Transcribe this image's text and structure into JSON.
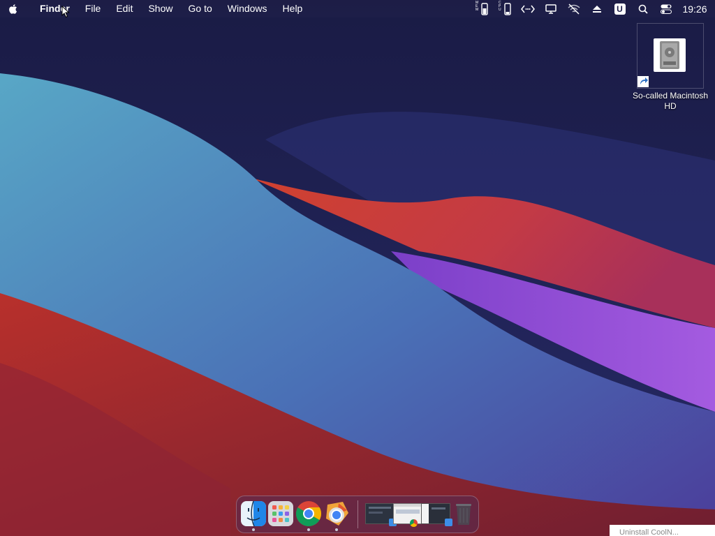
{
  "menubar": {
    "apple_icon": "apple-logo-icon",
    "items": [
      "Finder",
      "File",
      "Edit",
      "Show",
      "Go to",
      "Windows",
      "Help"
    ],
    "status_icons": [
      "memory-monitor-icon",
      "cpu-monitor-icon",
      "code-icon",
      "display-icon",
      "wifi-off-icon",
      "eject-icon",
      "u-app-icon",
      "search-icon",
      "control-center-icon"
    ],
    "mem_label": "MEM",
    "cpu_label": "CPU",
    "u_label": "U",
    "clock": "19:26"
  },
  "desktop": {
    "drive_label": "So-called Macintosh HD"
  },
  "dock": {
    "apps": [
      "finder-icon",
      "launchpad-icon",
      "chrome-icon",
      "chrome-alt-icon"
    ],
    "recent": [
      "window-thumbnail-1",
      "window-thumbnail-2",
      "window-thumbnail-3"
    ],
    "trash": "trash-icon"
  },
  "notice": {
    "text": "Uninstall CoolN..."
  },
  "colors": {
    "sky": "#1b1d4a",
    "blue_wave": "#4f9dc3",
    "red_wave": "#c23a34",
    "purple_wave": "#9a55d8",
    "menubar": "#1d1e48"
  }
}
